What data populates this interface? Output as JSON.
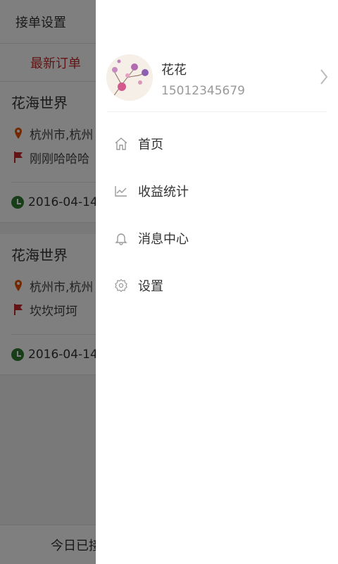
{
  "background": {
    "header_title": "接单设置",
    "tab_label": "最新订单",
    "orders": [
      {
        "title": "花海世界",
        "address": "杭州市,杭州",
        "note": "刚刚哈哈哈",
        "time": "2016-04-14"
      },
      {
        "title": "花海世界",
        "address": "杭州市,杭州",
        "note": "坎坎坷坷",
        "time": "2016-04-14"
      }
    ],
    "footer_text": "今日已接"
  },
  "drawer": {
    "user": {
      "name": "花花",
      "phone": "15012345679"
    },
    "menu": [
      {
        "label": "首页",
        "icon": "home-icon"
      },
      {
        "label": "收益统计",
        "icon": "chart-icon"
      },
      {
        "label": "消息中心",
        "icon": "bell-icon"
      },
      {
        "label": "设置",
        "icon": "gear-icon"
      }
    ]
  },
  "colors": {
    "accent": "#c62828",
    "clock": "#2e7d32",
    "pin": "#e65100"
  }
}
